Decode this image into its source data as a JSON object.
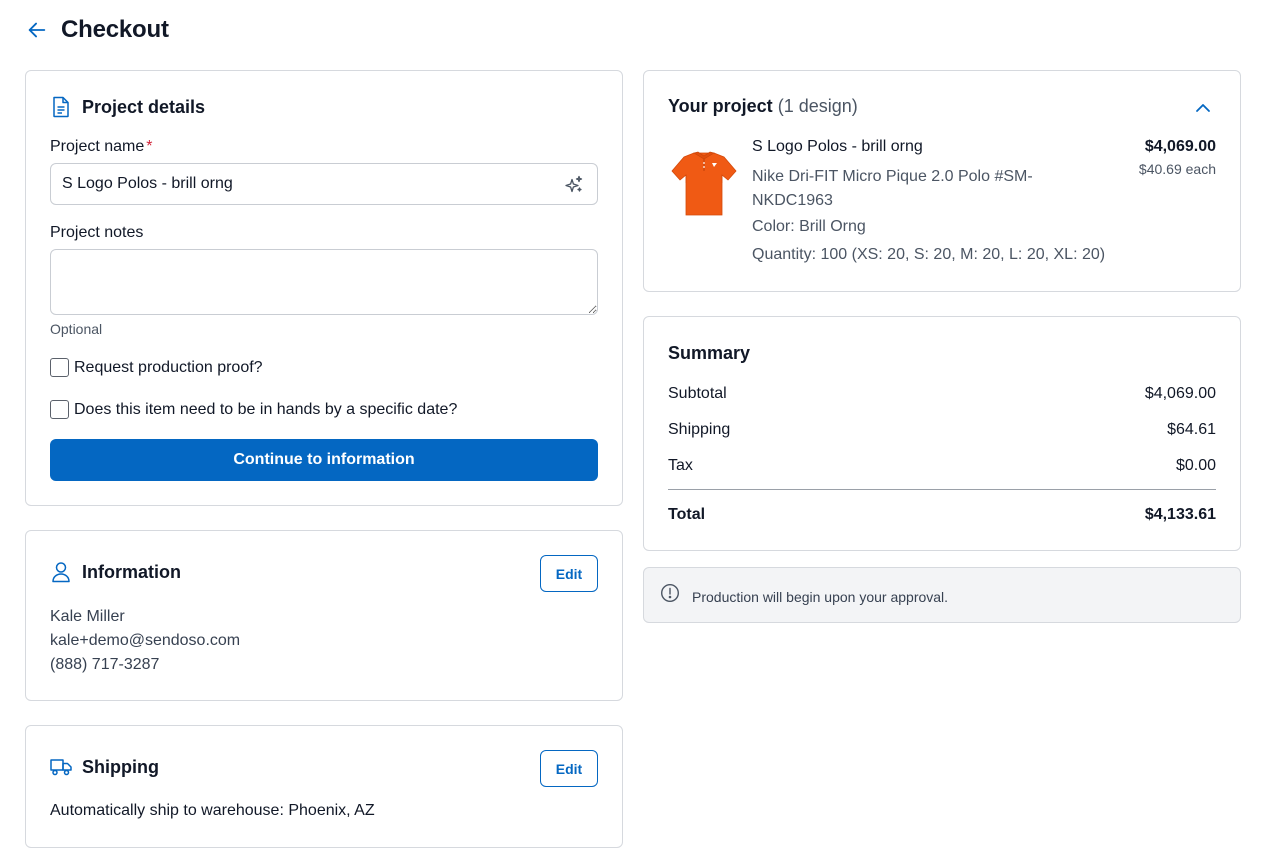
{
  "header": {
    "title": "Checkout",
    "back_icon": "arrow-left-icon"
  },
  "colors": {
    "primary": "#0467c2",
    "required": "#d1243a",
    "notice_bg": "#f3f4f6"
  },
  "project_details": {
    "title": "Project details",
    "icon": "document-icon",
    "name_label": "Project name",
    "required_marker": "*",
    "name_value": "S Logo Polos - brill orng",
    "notes_label": "Project notes",
    "notes_value": "",
    "notes_helper": "Optional",
    "proof_label": "Request production proof?",
    "in_hands_label": "Does this item need to be in hands by a specific date?",
    "continue_label": "Continue to information"
  },
  "information": {
    "title": "Information",
    "icon": "user-icon",
    "edit_label": "Edit",
    "name": "Kale Miller",
    "email": "kale+demo@sendoso.com",
    "phone": "(888) 717-3287"
  },
  "shipping": {
    "title": "Shipping",
    "icon": "truck-icon",
    "edit_label": "Edit",
    "text": "Automatically ship to warehouse: Phoenix, AZ"
  },
  "your_project": {
    "title": "Your project",
    "count": "(1 design)",
    "item": {
      "name": "S Logo Polos - brill orng",
      "description": "Nike Dri-FIT Micro Pique 2.0 Polo #SM-NKDC1963",
      "color": "Color: Brill Orng",
      "quantity": "Quantity: 100 (XS: 20, S: 20, M: 20, L: 20, XL: 20)",
      "price": "$4,069.00",
      "each": "$40.69 each"
    }
  },
  "summary": {
    "title": "Summary",
    "subtotal_label": "Subtotal",
    "subtotal": "$4,069.00",
    "shipping_label": "Shipping",
    "shipping": "$64.61",
    "tax_label": "Tax",
    "tax": "$0.00",
    "total_label": "Total",
    "total": "$4,133.61"
  },
  "notice": {
    "icon": "info-circle-icon",
    "text": "Production will begin upon your approval."
  }
}
